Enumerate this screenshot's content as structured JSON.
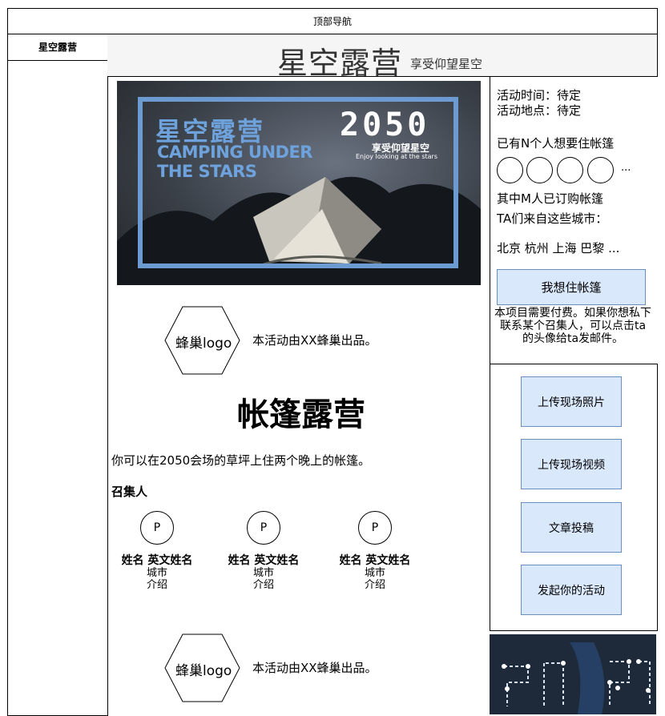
{
  "topnav": {
    "label": "顶部导航"
  },
  "sidebar": {
    "title": "星空露营"
  },
  "header": {
    "title": "星空露营",
    "subtitle": "享受仰望星空"
  },
  "banner": {
    "title_cn": "星空露营",
    "title_en_line1": "CAMPING UNDER",
    "title_en_line2": "THE STARS",
    "year": "2050",
    "slogan_cn": "享受仰望星空",
    "slogan_en": "Enjoy looking at the stars"
  },
  "organizer": {
    "logo_label": "蜂巢logo",
    "produced_by": "本活动由XX蜂巢出品。"
  },
  "event": {
    "title": "帐篷露营",
    "description": "你可以在2050会场的草坪上住两个晚上的帐篷。"
  },
  "conveners": {
    "label": "召集人",
    "items": [
      {
        "avatar": "P",
        "name": "姓名 英文姓名",
        "city": "城市",
        "intro": "介绍"
      },
      {
        "avatar": "P",
        "name": "姓名 英文姓名",
        "city": "城市",
        "intro": "介绍"
      },
      {
        "avatar": "P",
        "name": "姓名 英文姓名",
        "city": "城市",
        "intro": "介绍"
      }
    ]
  },
  "info": {
    "time": "活动时间：待定",
    "place": "活动地点：待定",
    "want_count": "已有N个人想要住帐篷",
    "more": "...",
    "ordered": "其中M人已订购帐篷",
    "cities_label": "TA们来自这些城市：",
    "cities": "北京 杭州 上海 巴黎 ..."
  },
  "want_button": "我想住帐篷",
  "pay_note": "本项目需要付费。如果你想私下联系某个召集人，可以点击ta的头像给ta发邮件。",
  "actions": [
    "上传现场照片",
    "上传现场视频",
    "文章投稿",
    "发起你的活动"
  ],
  "colors": {
    "button_fill": "#dae8fc",
    "button_border": "#6c8ebf",
    "banner_accent": "#6b9bd1"
  }
}
